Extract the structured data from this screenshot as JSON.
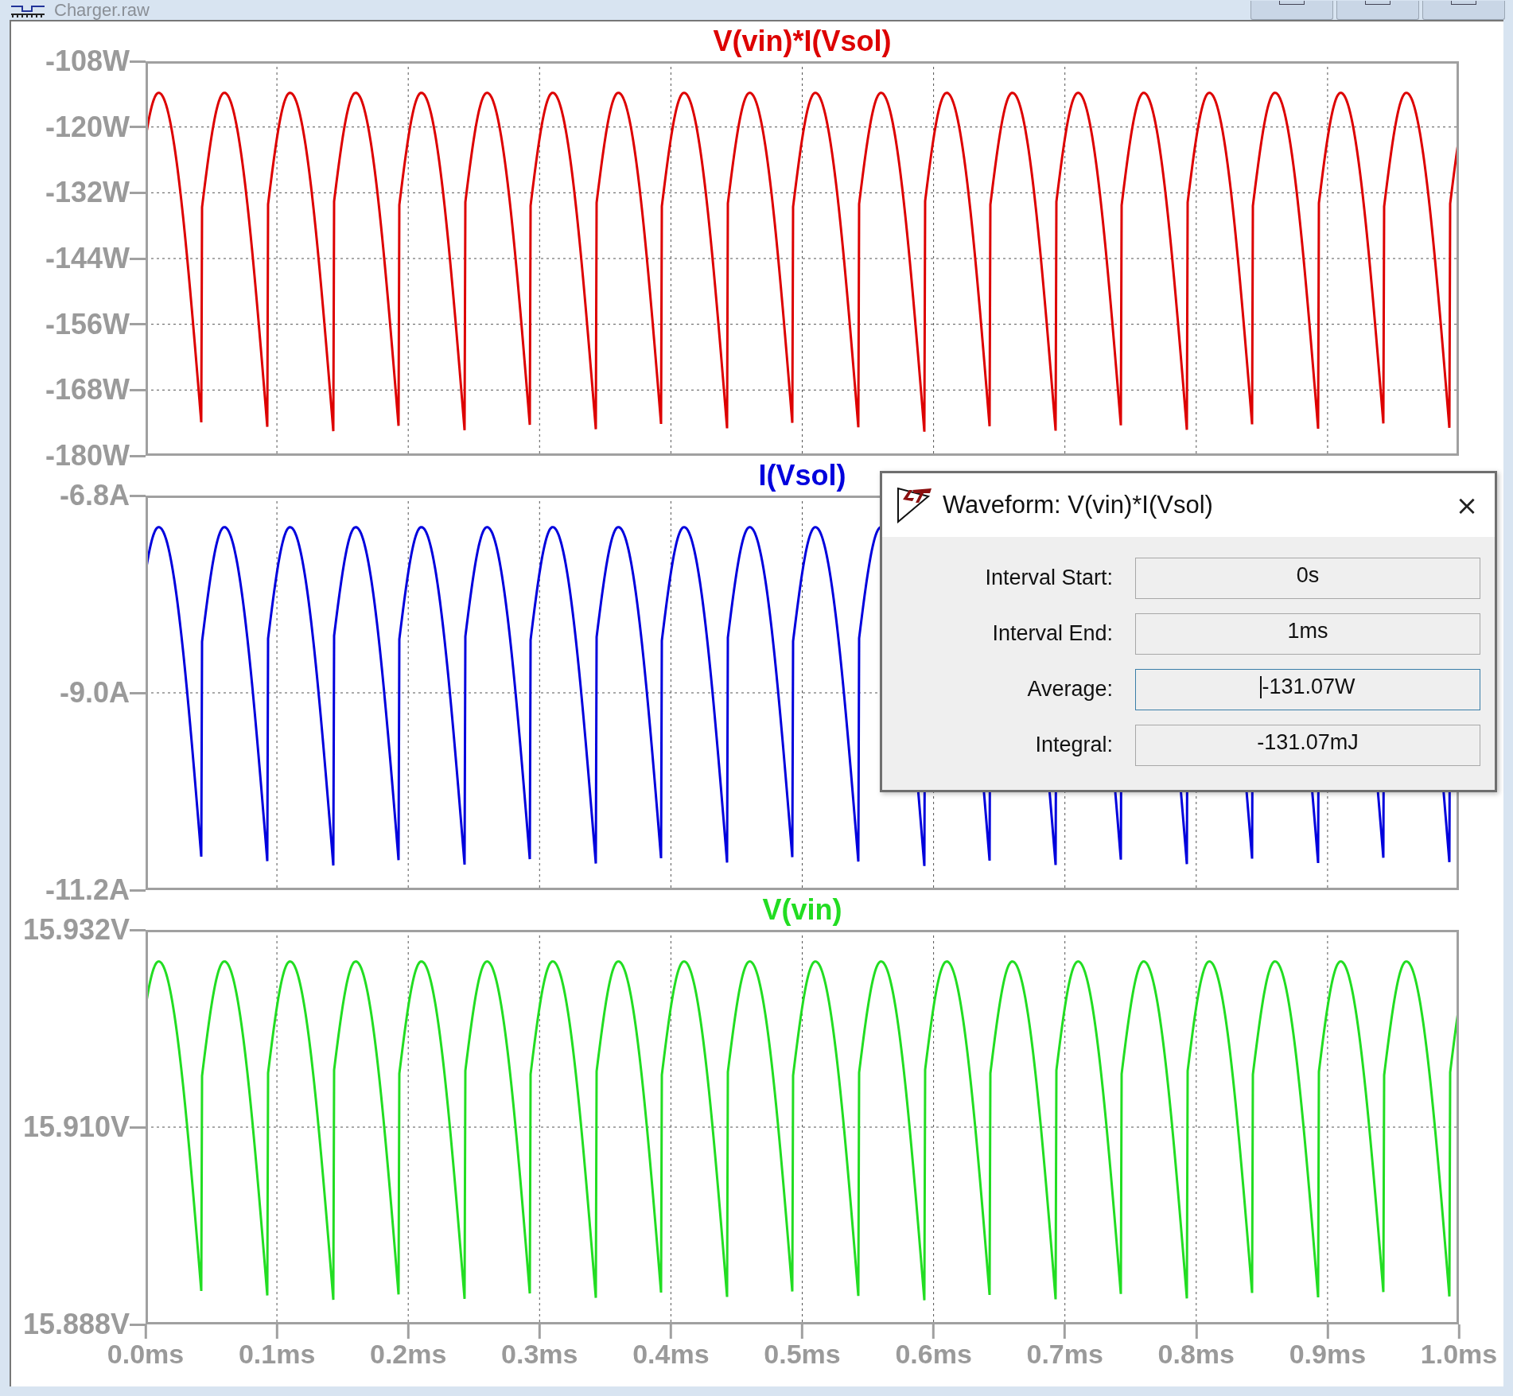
{
  "window": {
    "title": "Charger.raw"
  },
  "panels": [
    {
      "trace": "V(vin)*I(Vsol)",
      "color": "#dd0000",
      "yticks": [
        "-108W",
        "-120W",
        "-132W",
        "-144W",
        "-156W",
        "-168W",
        "-180W"
      ]
    },
    {
      "trace": "I(Vsol)",
      "color": "#0000dd",
      "yticks": [
        "-6.8A",
        "-9.0A",
        "-11.2A"
      ]
    },
    {
      "trace": "V(vin)",
      "color": "#22dd22",
      "yticks": [
        "15.932V",
        "15.910V",
        "15.888V"
      ]
    }
  ],
  "xticks": [
    "0.0ms",
    "0.1ms",
    "0.2ms",
    "0.3ms",
    "0.4ms",
    "0.5ms",
    "0.6ms",
    "0.7ms",
    "0.8ms",
    "0.9ms",
    "1.0ms"
  ],
  "dialog": {
    "title": "Waveform: V(vin)*I(Vsol)",
    "close": "×",
    "fields": [
      {
        "label": "Interval Start:",
        "value": "0s",
        "focused": false
      },
      {
        "label": "Interval End:",
        "value": "1ms",
        "focused": false
      },
      {
        "label": "Average:",
        "value": "-131.07W",
        "focused": true
      },
      {
        "label": "Integral:",
        "value": "-131.07mJ",
        "focused": false
      }
    ]
  }
}
